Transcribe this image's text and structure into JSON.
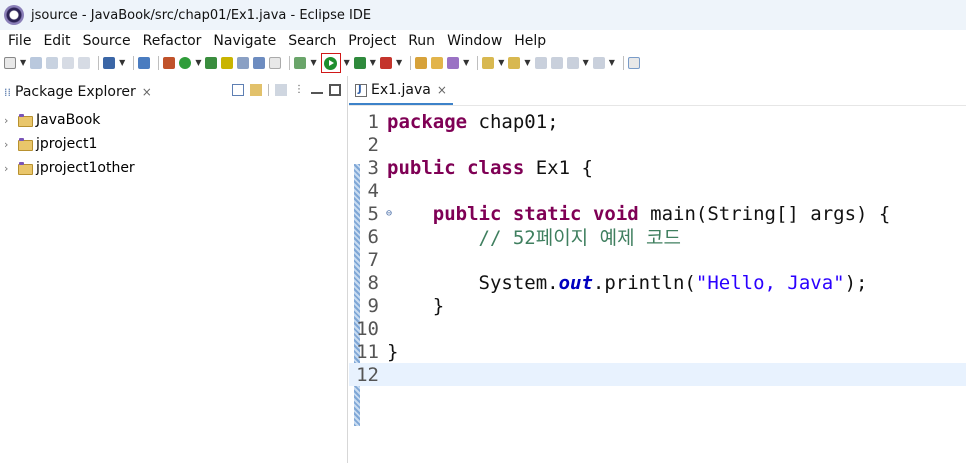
{
  "window": {
    "title": "jsource - JavaBook/src/chap01/Ex1.java - Eclipse IDE"
  },
  "menu": [
    "File",
    "Edit",
    "Source",
    "Refactor",
    "Navigate",
    "Search",
    "Project",
    "Run",
    "Window",
    "Help"
  ],
  "toolbar": {
    "icons": [
      "new",
      "save",
      "save-all",
      "undo",
      "redo",
      "console",
      "build",
      "debug",
      "coverage",
      "run",
      "external-tools",
      "search",
      "next-annotation",
      "prev-annotation",
      "back",
      "forward"
    ],
    "highlighted": "run"
  },
  "package_explorer": {
    "title": "Package Explorer",
    "close": "×",
    "projects": [
      "JavaBook",
      "jproject1",
      "jproject1other"
    ]
  },
  "editor": {
    "tab": {
      "label": "Ex1.java",
      "close": "×"
    },
    "lines": [
      {
        "n": "1",
        "parts": [
          [
            "kw",
            "package"
          ],
          [
            "code",
            " chap01;"
          ]
        ]
      },
      {
        "n": "2",
        "parts": []
      },
      {
        "n": "3",
        "parts": [
          [
            "kw",
            "public"
          ],
          [
            "code",
            " "
          ],
          [
            "kw",
            "class"
          ],
          [
            "code",
            " Ex1 {"
          ]
        ]
      },
      {
        "n": "4",
        "parts": []
      },
      {
        "n": "5",
        "fold": "⊖",
        "parts": [
          [
            "code",
            "    "
          ],
          [
            "kw",
            "public"
          ],
          [
            "code",
            " "
          ],
          [
            "kw",
            "static"
          ],
          [
            "code",
            " "
          ],
          [
            "kw",
            "void"
          ],
          [
            "code",
            " main(String[] args) {"
          ]
        ]
      },
      {
        "n": "6",
        "parts": [
          [
            "code",
            "        "
          ],
          [
            "cmt",
            "// 52페이지 예제 코드"
          ]
        ]
      },
      {
        "n": "7",
        "parts": []
      },
      {
        "n": "8",
        "parts": [
          [
            "code",
            "        System."
          ],
          [
            "fld",
            "out"
          ],
          [
            "code",
            ".println("
          ],
          [
            "str",
            "\"Hello, Java\""
          ],
          [
            "code",
            ");"
          ]
        ]
      },
      {
        "n": "9",
        "parts": [
          [
            "code",
            "    }"
          ]
        ]
      },
      {
        "n": "10",
        "parts": []
      },
      {
        "n": "11",
        "parts": [
          [
            "code",
            "}"
          ]
        ]
      },
      {
        "n": "12",
        "parts": [],
        "current": true
      }
    ]
  },
  "colors": {
    "keyword": "#7f0055",
    "comment": "#3f7f5f",
    "string": "#2a00ff",
    "field": "#0000c0",
    "run_highlight": "#d01818"
  }
}
